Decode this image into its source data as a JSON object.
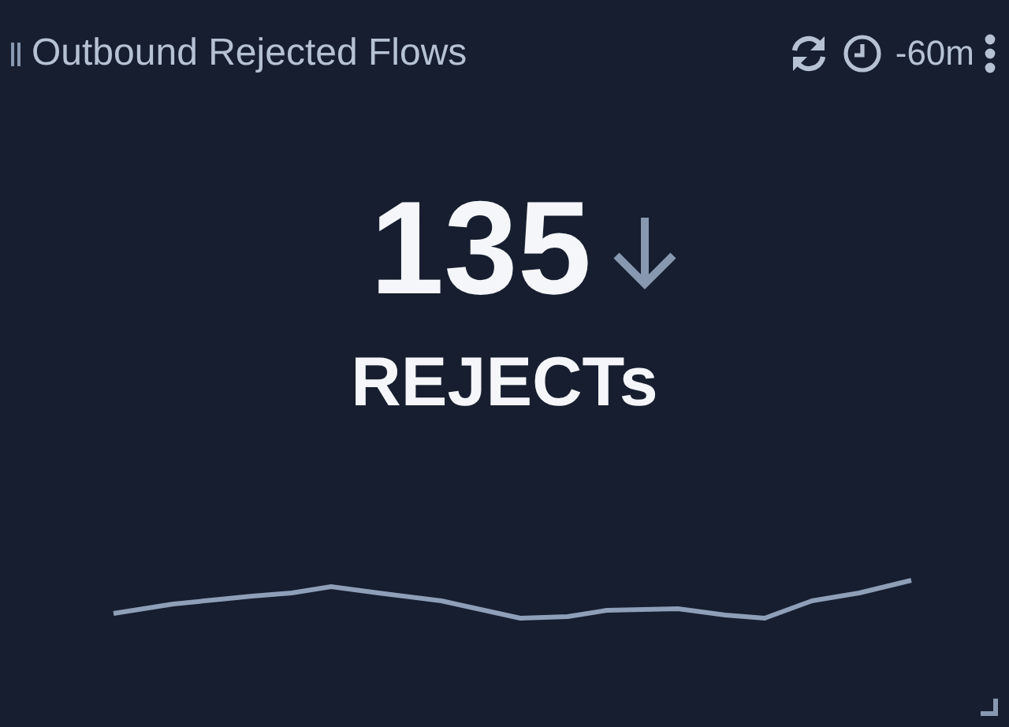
{
  "widget": {
    "title": "Outbound Rejected Flows",
    "time_range": "-60m"
  },
  "metric": {
    "value": "135",
    "decreasing": true,
    "unit": "REJECTs"
  }
}
